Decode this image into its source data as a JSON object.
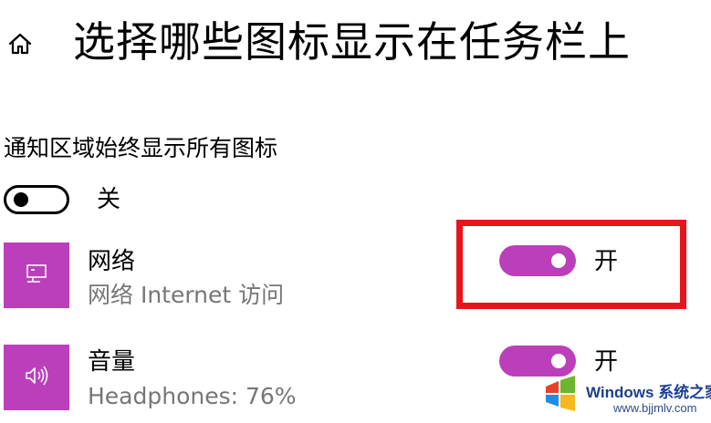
{
  "header": {
    "home_icon": "home-icon",
    "title": "选择哪些图标显示在任务栏上"
  },
  "notification_area": {
    "label": "通知区域始终显示所有图标",
    "toggle_state": "off",
    "toggle_label": "关"
  },
  "apps": [
    {
      "icon": "network-monitor-icon",
      "name": "网络",
      "subtitle": "网络 Internet 访问",
      "toggle_state": "on",
      "toggle_label": "开"
    },
    {
      "icon": "speaker-volume-icon",
      "name": "音量",
      "subtitle": "Headphones: 76%",
      "toggle_state": "on",
      "toggle_label": "开"
    }
  ],
  "watermark": {
    "brand": "Windows",
    "brand_cn": "系统之家",
    "url": "www.bjjmlv.com"
  },
  "colors": {
    "accent": "#bb3fbb",
    "highlight": "#e8141c",
    "secondary_text": "#767676",
    "watermark_blue": "#1b3f8f"
  }
}
